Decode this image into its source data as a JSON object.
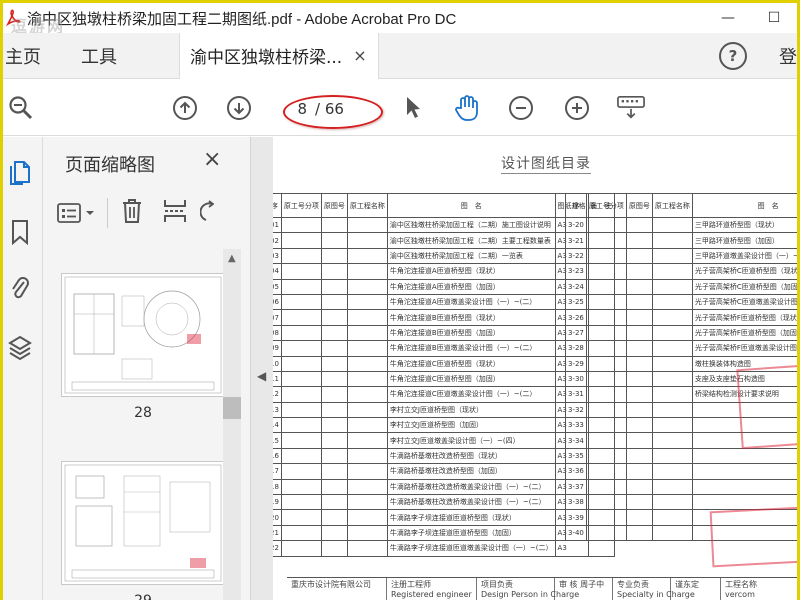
{
  "window": {
    "title": "渝中区独墩柱桥梁加固工程二期图纸.pdf - Adobe Acrobat Pro DC",
    "watermark": "逗游网",
    "minimize": "—",
    "maximize": "☐"
  },
  "tabs": {
    "home": "主页",
    "tools": "工具",
    "document": "渝中区独墩柱桥梁...",
    "document_close": "×",
    "help": "?",
    "signin": "登"
  },
  "toolbar": {
    "current_page": "8",
    "page_separator": "/ 66",
    "zoom_icon": "zoom-icon",
    "prev_icon": "arrow-up-icon",
    "next_icon": "arrow-down-icon",
    "select_icon": "cursor-icon",
    "hand_icon": "hand-icon",
    "zoom_out_icon": "minus-icon",
    "zoom_in_icon": "plus-icon",
    "keyboard_icon": "keyboard-icon",
    "annotation_color": "#d42020"
  },
  "sidebar": {
    "title": "页面缩略图",
    "close": "×",
    "thumbnails": [
      {
        "label": "28"
      },
      {
        "label": "29"
      }
    ]
  },
  "document": {
    "title": "设计图纸目录",
    "left_headers": [
      "序",
      "原工号分项",
      "原图号",
      "原工程名称",
      "图　名",
      "图纸规格",
      "备　注"
    ],
    "left_rows": [
      {
        "no": "01",
        "name": "渝中区独墩柱桥梁加固工程（二期）施工图设计说明",
        "size": "A3"
      },
      {
        "no": "02",
        "name": "渝中区独墩柱桥梁加固工程（二期）主要工程数量表",
        "size": "A3"
      },
      {
        "no": "03",
        "name": "渝中区独墩柱桥梁加固工程（二期）一览表",
        "size": "A3"
      },
      {
        "no": "04",
        "name": "牛角沱连接道A匝道桥型图（现状）",
        "size": "A3"
      },
      {
        "no": "05",
        "name": "牛角沱连接道A匝道桥型图（加固）",
        "size": "A3"
      },
      {
        "no": "06",
        "name": "牛角沱连接道A匝道墩盖梁设计图（一）~(二）",
        "size": "A3"
      },
      {
        "no": "07",
        "name": "牛角沱连接道B匝道桥型图（现状）",
        "size": "A3"
      },
      {
        "no": "08",
        "name": "牛角沱连接道B匝道桥型图（加固）",
        "size": "A3"
      },
      {
        "no": "09",
        "name": "牛角沱连接道B匝道墩盖梁设计图（一）~(二）",
        "size": "A3"
      },
      {
        "no": "10",
        "name": "牛角沱连接道C匝道桥型图（现状）",
        "size": "A3"
      },
      {
        "no": "11",
        "name": "牛角沱连接道C匝道桥型图（加固）",
        "size": "A3"
      },
      {
        "no": "12",
        "name": "牛角沱连接道C匝道墩盖梁设计图（一）~(二）",
        "size": "A3"
      },
      {
        "no": "13",
        "name": "李村立交J匝道桥型图（现状）",
        "size": "A3"
      },
      {
        "no": "14",
        "name": "李村立交J匝道桥型图（加固）",
        "size": "A3"
      },
      {
        "no": "15",
        "name": "李村立交J匝道墩盖梁设计图（一）~(四）",
        "size": "A3"
      },
      {
        "no": "16",
        "name": "牛滴路桥基墩柱改造桥型图（现状）",
        "size": "A3"
      },
      {
        "no": "17",
        "name": "牛滴路桥基墩柱改造桥型图（加固）",
        "size": "A3"
      },
      {
        "no": "18",
        "name": "牛滴路桥基墩柱改造桥墩盖梁设计图（一）~(二）",
        "size": "A3"
      },
      {
        "no": "19",
        "name": "牛滴路桥基墩柱改造桥墩盖梁设计图（一）~(二）",
        "size": "A3"
      },
      {
        "no": "20",
        "name": "牛滴路李子坝连接道匝道桥型图（现状）",
        "size": "A3"
      },
      {
        "no": "21",
        "name": "牛滴路李子坝连接道匝道桥型图（加固）",
        "size": "A3"
      },
      {
        "no": "22",
        "name": "牛滴路李子坝连接道匝道墩盖梁设计图（一）~(二）",
        "size": "A3"
      }
    ],
    "right_rows": [
      {
        "no": "3-20",
        "name": "三甲路环道桥型图（现状）",
        "size": "A3"
      },
      {
        "no": "3-21",
        "name": "三甲路环道桥型图（加固）",
        "size": "A3"
      },
      {
        "no": "3-22",
        "name": "三甲路环道墩盖梁设计图（一）~(二）",
        "size": "A3"
      },
      {
        "no": "3-23",
        "name": "光子营高架桥C匝道桥型图（现状）",
        "size": "A3"
      },
      {
        "no": "3-24",
        "name": "光子营高架桥C匝道桥型图（加固）",
        "size": "A3"
      },
      {
        "no": "3-25",
        "name": "光子营高架桥C匝道墩盖梁设计图（一）~(二）",
        "size": "A3"
      },
      {
        "no": "3-26",
        "name": "光子营高架桥F匝道桥型图（现状）",
        "size": "A3"
      },
      {
        "no": "3-27",
        "name": "光子营高架桥F匝道桥型图（加固）",
        "size": "A3"
      },
      {
        "no": "3-28",
        "name": "光子营高架桥F匝道墩盖梁设计图（一）~(二）",
        "size": "A3"
      },
      {
        "no": "3-29",
        "name": "墩柱换装体构造图",
        "size": "A3"
      },
      {
        "no": "3-30",
        "name": "支座及支座垫石构造图",
        "size": "A3"
      },
      {
        "no": "3-31",
        "name": "桥梁结构检测设计要求说明",
        "size": "A3"
      },
      {
        "no": "3-32",
        "name": "",
        "size": ""
      },
      {
        "no": "3-33",
        "name": "",
        "size": ""
      },
      {
        "no": "3-34",
        "name": "",
        "size": ""
      },
      {
        "no": "3-35",
        "name": "",
        "size": ""
      },
      {
        "no": "3-36",
        "name": "",
        "size": ""
      },
      {
        "no": "3-37",
        "name": "",
        "size": ""
      },
      {
        "no": "3-38",
        "name": "",
        "size": ""
      },
      {
        "no": "3-39",
        "name": "",
        "size": ""
      },
      {
        "no": "3-40",
        "name": "",
        "size": ""
      }
    ],
    "footer": {
      "org": "重庆市设计院有限公司",
      "engineer": "注册工程师",
      "engineer_en": "Registered engineer",
      "project_lead": "项目负责",
      "project_lead_en": "Design Person in Charge",
      "checker": "审 核",
      "checker_name": "周子中",
      "professional": "专业负责",
      "professional_en": "Specialty in Charge",
      "reviewer": "谨东定",
      "project": "工程名称",
      "project_en": "Project",
      "site": "vercom"
    }
  }
}
